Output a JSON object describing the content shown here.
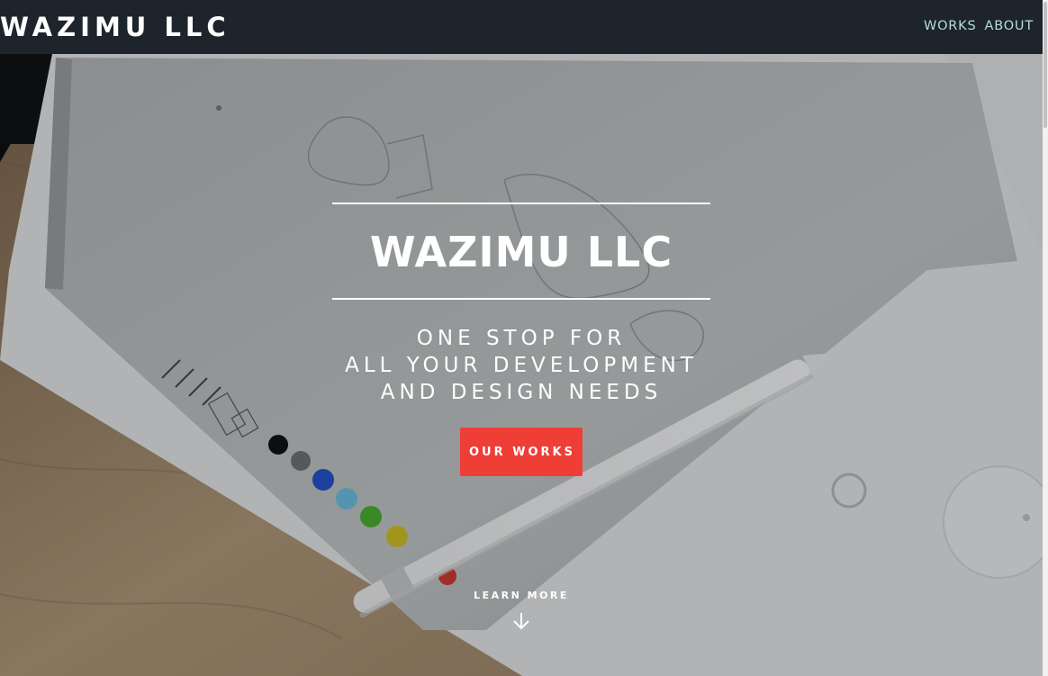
{
  "navbar": {
    "brand": "WAZIMU LLC",
    "links": [
      {
        "label": "WORKS"
      },
      {
        "label": "ABOUT"
      }
    ]
  },
  "hero": {
    "title": "WAZIMU LLC",
    "tagline": [
      "ONE STOP FOR",
      "ALL YOUR DEVELOPMENT",
      "AND DESIGN NEEDS"
    ],
    "cta_label": "OUR WORKS",
    "learn_more_label": "LEARN MORE",
    "learn_more_icon": "arrow-down-icon",
    "background_image": "tablet-with-stylus-photo"
  },
  "colors": {
    "navbar_bg": "#1d242b",
    "nav_link": "#b7dde0",
    "cta_bg": "#ee3e36",
    "text": "#ffffff"
  }
}
